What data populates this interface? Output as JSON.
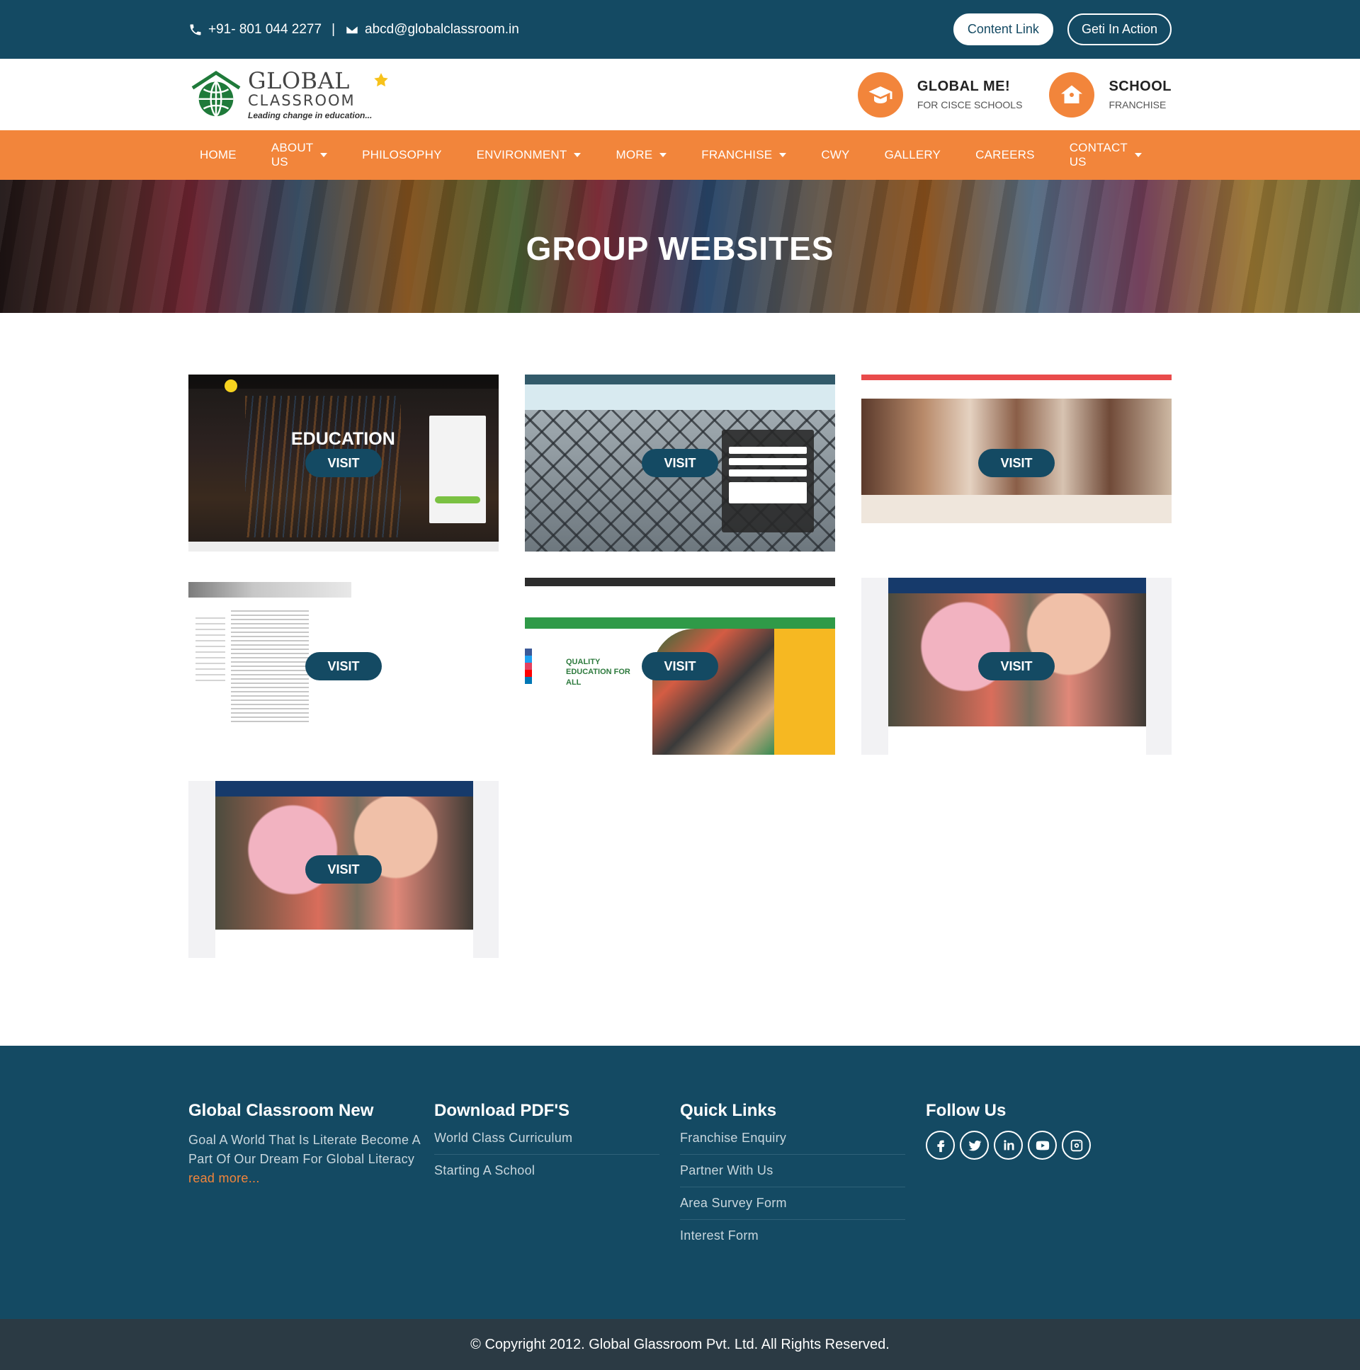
{
  "topbar": {
    "phone": "+91- 801 044 2277",
    "separator": "|",
    "email": "abcd@globalclassroom.in",
    "buttons": [
      "Content Link",
      "Geti In Action"
    ]
  },
  "logo": {
    "main": "GLOBAL",
    "sub": "CLASSROOM",
    "tagline": "Leading change in education..."
  },
  "header_cards": [
    {
      "title": "GLOBAL ME!",
      "subtitle": "FOR CISCE SCHOOLS",
      "icon": "graduation-cap-icon"
    },
    {
      "title": "SCHOOL",
      "subtitle": "FRANCHISE",
      "icon": "home-school-icon"
    }
  ],
  "nav": [
    {
      "label": "HOME",
      "dropdown": false
    },
    {
      "label": "ABOUT US",
      "dropdown": true
    },
    {
      "label": "PHILOSOPHY",
      "dropdown": false
    },
    {
      "label": "ENVIRONMENT",
      "dropdown": true
    },
    {
      "label": "MORE",
      "dropdown": true
    },
    {
      "label": "FRANCHISE",
      "dropdown": true
    },
    {
      "label": "CWY",
      "dropdown": false
    },
    {
      "label": "GALLERY",
      "dropdown": false
    },
    {
      "label": "CAREERS",
      "dropdown": false
    },
    {
      "label": "CONTACT US",
      "dropdown": true
    }
  ],
  "banner": {
    "title": "GROUP WEBSITES"
  },
  "cards": {
    "visit_label": "VISIT",
    "c1_title": "EDUCATION",
    "c5_title": "QUALITY EDUCATION FOR ALL"
  },
  "footer": {
    "col1": {
      "title": "Global Classroom New",
      "text": "Goal A World That Is Literate Become A Part Of Our Dream For Global Literacy",
      "more": "read more..."
    },
    "col2": {
      "title": "Download PDF'S",
      "links": [
        "World Class Curriculum",
        "Starting A School"
      ]
    },
    "col3": {
      "title": "Quick Links",
      "links": [
        "Franchise Enquiry",
        "Partner With Us",
        "Area Survey Form",
        "Interest Form"
      ]
    },
    "col4": {
      "title": "Follow Us",
      "icons": [
        "facebook-icon",
        "twitter-icon",
        "linkedin-icon",
        "youtube-icon",
        "instagram-icon"
      ]
    }
  },
  "copyright": "© Copyright 2012. Global Glassroom Pvt. Ltd. All Rights Reserved.",
  "colors": {
    "primary": "#144a63",
    "accent": "#f2853b",
    "footer_bottom": "#2b3a44"
  }
}
